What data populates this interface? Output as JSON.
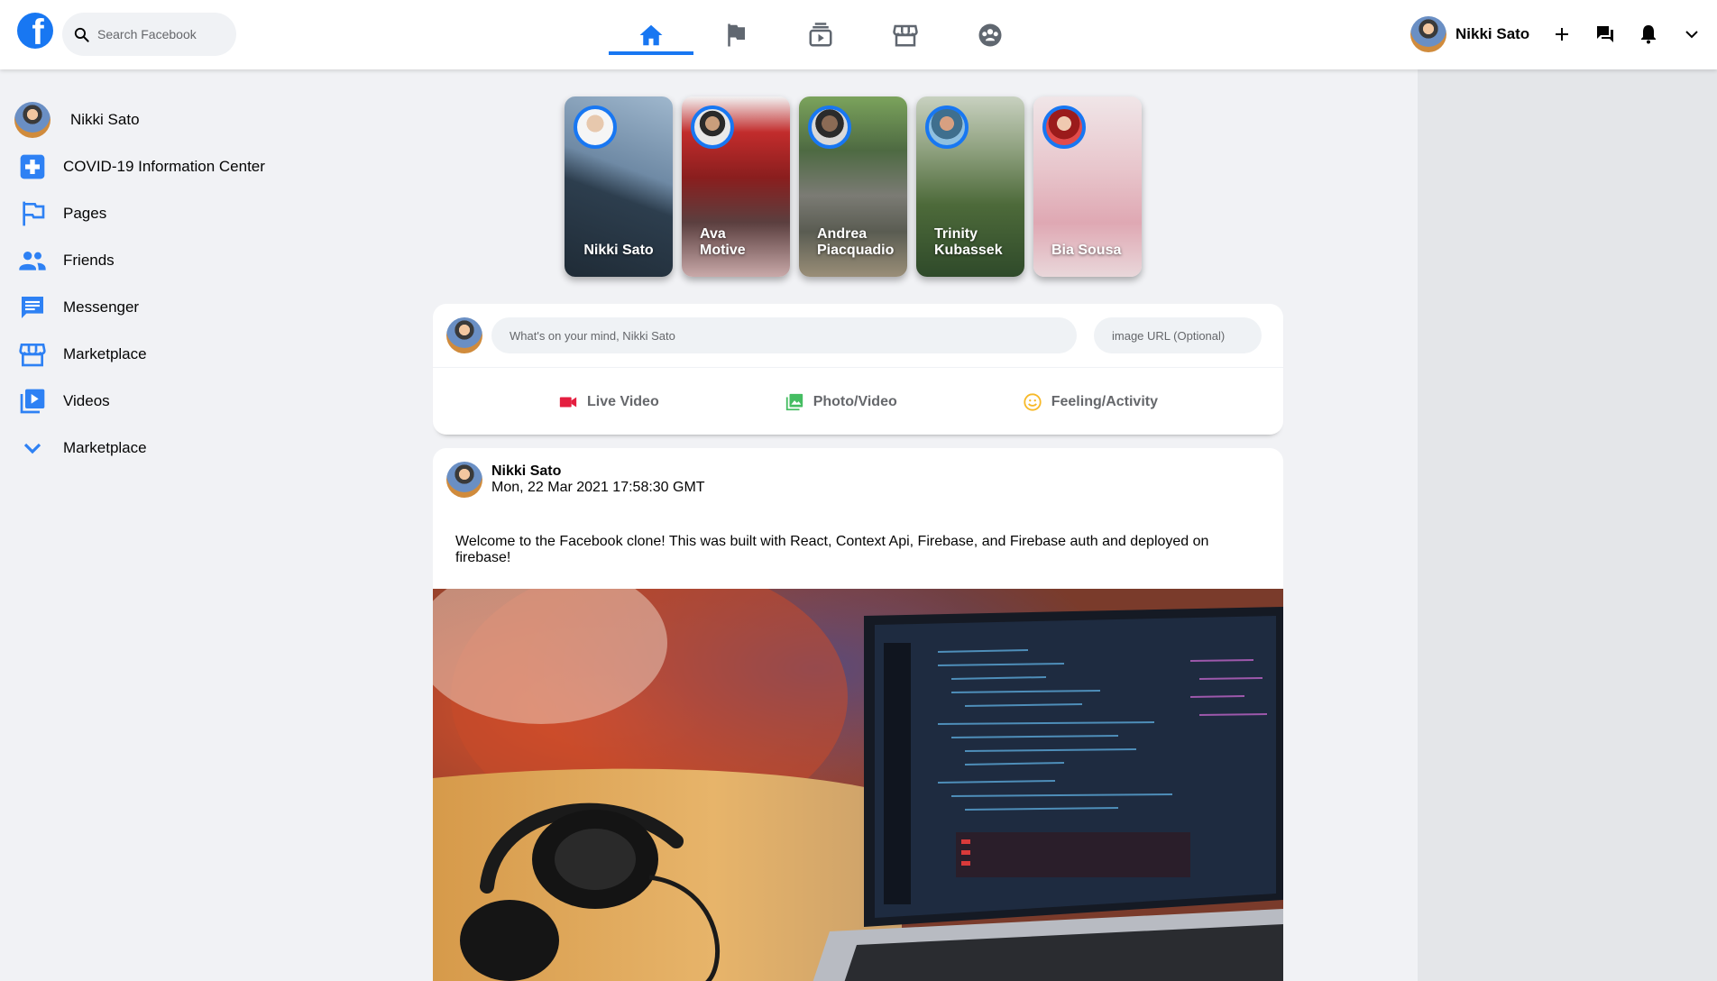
{
  "header": {
    "logo": "f",
    "search_placeholder": "Search Facebook",
    "nav": [
      {
        "name": "home",
        "active": true
      },
      {
        "name": "pages"
      },
      {
        "name": "watch"
      },
      {
        "name": "marketplace"
      },
      {
        "name": "groups"
      }
    ],
    "user_name": "Nikki Sato",
    "accent": "#1877f2"
  },
  "sidebar": {
    "items": [
      {
        "label": "Nikki Sato",
        "icon": "avatar"
      },
      {
        "label": "COVID-19 Information Center",
        "icon": "medical-cross-icon"
      },
      {
        "label": "Pages",
        "icon": "flag-icon"
      },
      {
        "label": "Friends",
        "icon": "people-icon"
      },
      {
        "label": "Messenger",
        "icon": "chat-icon"
      },
      {
        "label": "Marketplace",
        "icon": "storefront-icon"
      },
      {
        "label": "Videos",
        "icon": "video-library-icon"
      },
      {
        "label": "Marketplace",
        "icon": "chevron-down-icon"
      }
    ]
  },
  "stories": [
    {
      "name": "Nikki Sato"
    },
    {
      "name": "Ava Motive"
    },
    {
      "name": "Andrea Piacquadio"
    },
    {
      "name": "Trinity Kubassek"
    },
    {
      "name": "Bia Sousa"
    }
  ],
  "composer": {
    "placeholder": "What's on your mind, Nikki Sato",
    "url_placeholder": "image URL (Optional)",
    "options": [
      {
        "label": "Live Video",
        "color": "#e41e3f"
      },
      {
        "label": "Photo/Video",
        "color": "#45bd62"
      },
      {
        "label": "Feeling/Activity",
        "color": "#f7b928"
      }
    ]
  },
  "post": {
    "author": "Nikki Sato",
    "timestamp": "Mon, 22 Mar 2021 17:58:30 GMT",
    "message": "Welcome to the Facebook clone! This was built with React, Context Api, Firebase, and Firebase auth and deployed on firebase!"
  }
}
